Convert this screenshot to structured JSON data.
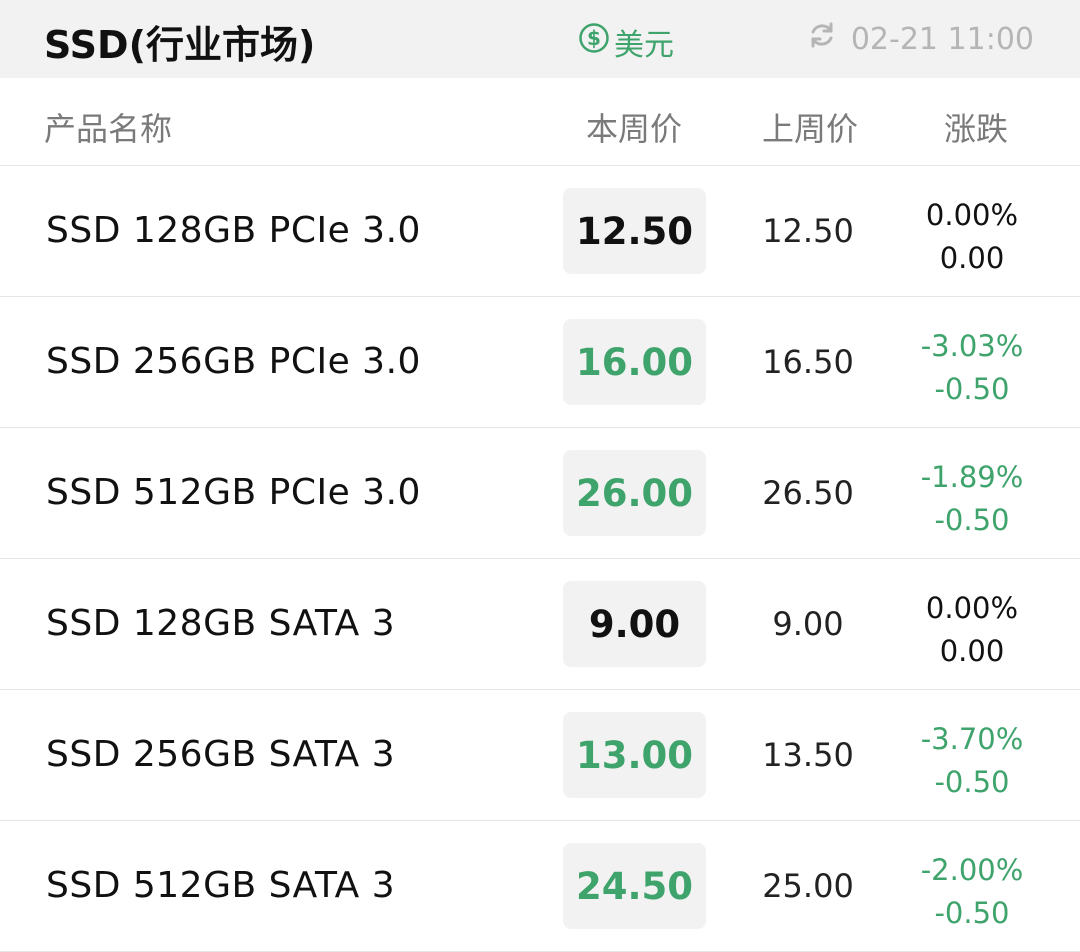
{
  "header": {
    "title": "SSD(行业市场)",
    "currency_label": "美元",
    "update_time": "02-21 11:00"
  },
  "columns": {
    "name": "产品名称",
    "current": "本周价",
    "previous": "上周价",
    "change": "涨跌"
  },
  "colors": {
    "down": "#3fa36c",
    "neutral": "#111111"
  },
  "rows": [
    {
      "name": "SSD 128GB PCIe 3.0",
      "current": "12.50",
      "previous": "12.50",
      "change_pct": "0.00%",
      "change_abs": "0.00",
      "trend": "neutral"
    },
    {
      "name": "SSD 256GB PCIe 3.0",
      "current": "16.00",
      "previous": "16.50",
      "change_pct": "-3.03%",
      "change_abs": "-0.50",
      "trend": "down"
    },
    {
      "name": "SSD 512GB PCIe 3.0",
      "current": "26.00",
      "previous": "26.50",
      "change_pct": "-1.89%",
      "change_abs": "-0.50",
      "trend": "down"
    },
    {
      "name": "SSD 128GB SATA 3",
      "current": "9.00",
      "previous": "9.00",
      "change_pct": "0.00%",
      "change_abs": "0.00",
      "trend": "neutral"
    },
    {
      "name": "SSD 256GB SATA 3",
      "current": "13.00",
      "previous": "13.50",
      "change_pct": "-3.70%",
      "change_abs": "-0.50",
      "trend": "down"
    },
    {
      "name": "SSD 512GB SATA 3",
      "current": "24.50",
      "previous": "25.00",
      "change_pct": "-2.00%",
      "change_abs": "-0.50",
      "trend": "down"
    }
  ]
}
